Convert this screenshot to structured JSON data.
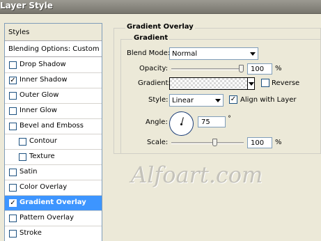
{
  "window": {
    "title": "Layer Style"
  },
  "styles_panel": {
    "header": "Styles",
    "blending_options": "Blending Options: Custom",
    "items": [
      {
        "label": "Drop Shadow",
        "checked": false,
        "indent": false,
        "selected": false
      },
      {
        "label": "Inner Shadow",
        "checked": true,
        "indent": false,
        "selected": false
      },
      {
        "label": "Outer Glow",
        "checked": false,
        "indent": false,
        "selected": false
      },
      {
        "label": "Inner Glow",
        "checked": false,
        "indent": false,
        "selected": false
      },
      {
        "label": "Bevel and Emboss",
        "checked": false,
        "indent": false,
        "selected": false
      },
      {
        "label": "Contour",
        "checked": false,
        "indent": true,
        "selected": false
      },
      {
        "label": "Texture",
        "checked": false,
        "indent": true,
        "selected": false
      },
      {
        "label": "Satin",
        "checked": false,
        "indent": false,
        "selected": false
      },
      {
        "label": "Color Overlay",
        "checked": false,
        "indent": false,
        "selected": false
      },
      {
        "label": "Gradient Overlay",
        "checked": true,
        "indent": false,
        "selected": true
      },
      {
        "label": "Pattern Overlay",
        "checked": false,
        "indent": false,
        "selected": false
      },
      {
        "label": "Stroke",
        "checked": false,
        "indent": false,
        "selected": false
      }
    ]
  },
  "gradient_overlay": {
    "section_title": "Gradient Overlay",
    "group_title": "Gradient",
    "blend_mode": {
      "label": "Blend Mode:",
      "value": "Normal"
    },
    "opacity": {
      "label": "Opacity:",
      "value": "100",
      "unit": "%",
      "level": 100
    },
    "gradient": {
      "label": "Gradient:",
      "reverse_label": "Reverse",
      "reverse_checked": false
    },
    "style": {
      "label": "Style:",
      "value": "Linear",
      "align_label": "Align with Layer",
      "align_checked": true
    },
    "angle": {
      "label": "Angle:",
      "value": "75",
      "unit": "°"
    },
    "scale": {
      "label": "Scale:",
      "value": "100",
      "unit": "%",
      "level": 100
    }
  },
  "watermark": "Alfoart.com",
  "colors": {
    "selection": "#3D95FF",
    "dialog_bg": "#ECE9D8",
    "title_bar": "#8B8981"
  }
}
